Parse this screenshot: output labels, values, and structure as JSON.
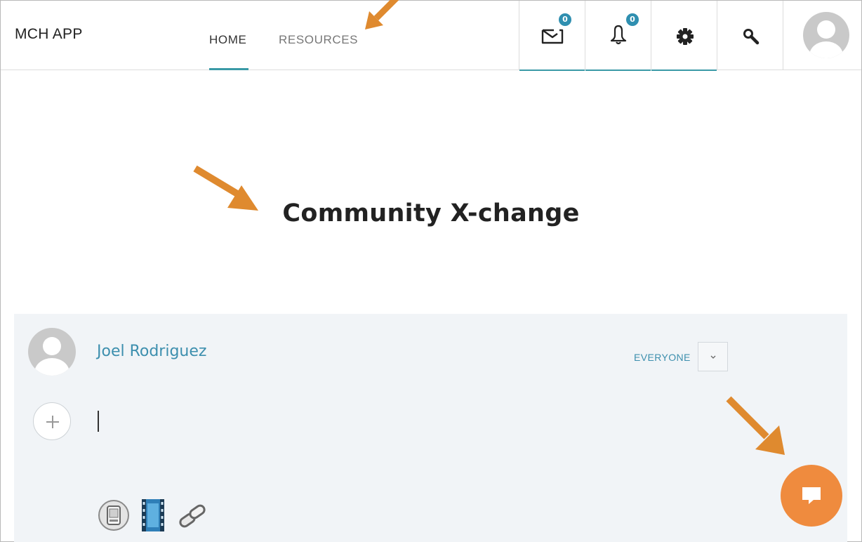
{
  "header": {
    "brand": "MCH APP",
    "nav": [
      {
        "label": "HOME",
        "active": true
      },
      {
        "label": "RESOURCES",
        "active": false
      }
    ],
    "messages_count": "0",
    "notifications_count": "0",
    "icons": [
      "mail-icon",
      "bell-icon",
      "gear-icon",
      "search-icon",
      "avatar"
    ]
  },
  "main": {
    "title": "Community X-change"
  },
  "composer": {
    "user_name": "Joel Rodriguez",
    "audience": "EVERYONE",
    "attachment_icons": [
      "phone-attachment-icon",
      "video-attachment-icon",
      "link-attachment-icon"
    ]
  },
  "colors": {
    "accent": "#3a9aa6",
    "badge": "#2f8fb0",
    "link": "#3d8fae",
    "fab": "#ef8b3e",
    "annotation_arrow": "#df8a2f",
    "composer_bg": "#f1f4f7"
  }
}
